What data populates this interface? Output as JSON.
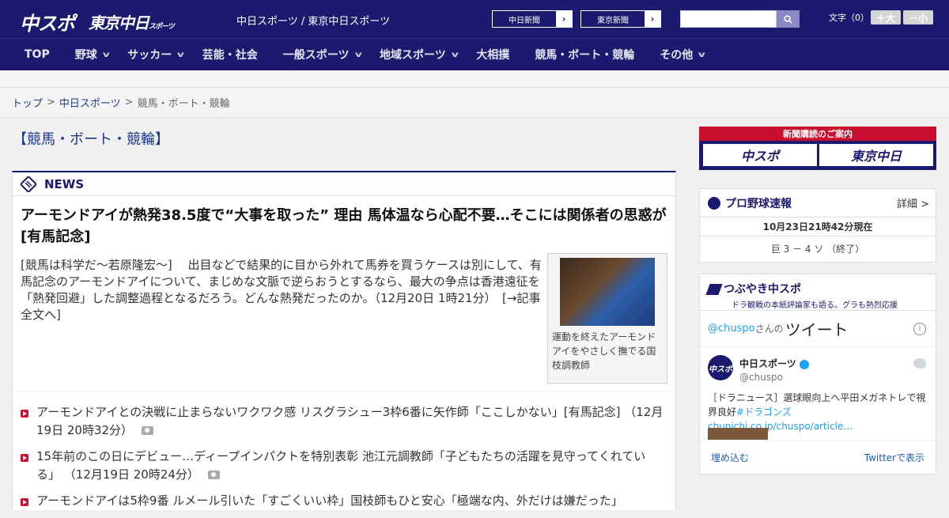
{
  "header": {
    "logo_primary": "中スポ",
    "logo_secondary": "東京中日",
    "logo_secondary_small": "スポーツ",
    "site_names": "中日スポーツ / 東京中日スポーツ",
    "links": [
      {
        "label": "中日新聞"
      },
      {
        "label": "東京新聞"
      }
    ],
    "search_placeholder": "",
    "font_label": "文字（0）",
    "font_up": "＋大",
    "font_down": "－小"
  },
  "nav": {
    "items": [
      {
        "label": "TOP",
        "dropdown": false
      },
      {
        "label": "野球",
        "dropdown": true
      },
      {
        "label": "サッカー",
        "dropdown": true
      },
      {
        "label": "芸能・社会",
        "dropdown": false
      },
      {
        "label": "一般スポーツ",
        "dropdown": true
      },
      {
        "label": "地域スポーツ",
        "dropdown": true
      },
      {
        "label": "大相撲",
        "dropdown": false
      },
      {
        "label": "競馬・ボート・競輪",
        "dropdown": false
      },
      {
        "label": "その他",
        "dropdown": true
      }
    ]
  },
  "breadcrumb": {
    "top": "トップ",
    "parent": "中日スポーツ",
    "current": "競馬・ボート・競輪",
    "sep": ">"
  },
  "main": {
    "category_title": "【競馬・ボート・競輪】",
    "news_label": "NEWS",
    "lead": {
      "title": "アーモンドアイが熱発38.5度で“大事を取った” 理由 馬体温なら心配不要…そこには関係者の思惑が[有馬記念]",
      "body": "[競馬は科学だ～若原隆宏～]　 出目などで結果的に目から外れて馬券を買うケースは別にして、有馬記念のアーモンドアイについて、まじめな文脈で逆らおうとするなら、最大の争点は香港遠征を「熱発回避」した調整過程となるだろう。どんな熱発だったのか。（12月20日 1時21分）　[→記事全文へ]",
      "caption": "運動を終えたアーモンドアイをやさしく撫でる国枝調教師"
    },
    "list": [
      {
        "title": "アーモンドアイとの決戦に止まらないワクワク感 リスグラシュー3枠6番に矢作師「ここしかない」[有馬記念]",
        "time": "（12月19日 20時32分）"
      },
      {
        "title": "15年前のこの日にデビュー…ディープインパクトを特別表彰 池江元調教師「子どもたちの活躍を見守ってくれている」",
        "time": "（12月19日 20時24分）"
      },
      {
        "title": "アーモンドアイは5枠9番 ルメール引いた「すごくいい枠」国枝師もひと安心「極端な内、外だけは嫌だった」",
        "time": ""
      }
    ]
  },
  "sidebar": {
    "ad_top": "新聞購読のご案内",
    "ad_logo1": "中スポ",
    "ad_logo2": "東京中日",
    "baseball": {
      "title": "プロ野球速報",
      "more": "詳細 >",
      "time": "10月23日21時42分現在",
      "score": "巨 3 － 4 ソ （終了）"
    },
    "twitter": {
      "title": "つぶやき中スポ",
      "subtitle": "ドラ観戦の本紙評論家も語る。グラも熱烈応援",
      "handle": "@chuspo",
      "handle_suffix": "さんの",
      "heading": "ツイート",
      "name": "中日スポーツ",
      "text_plain": "［ドラニュース］選球眼向上へ平田メガネトレで視界良好",
      "text_tag": "#ドラゴンズchunichi.co.jp/chuspo/article…",
      "embed": "埋め込む",
      "view": "Twitterで表示"
    }
  }
}
